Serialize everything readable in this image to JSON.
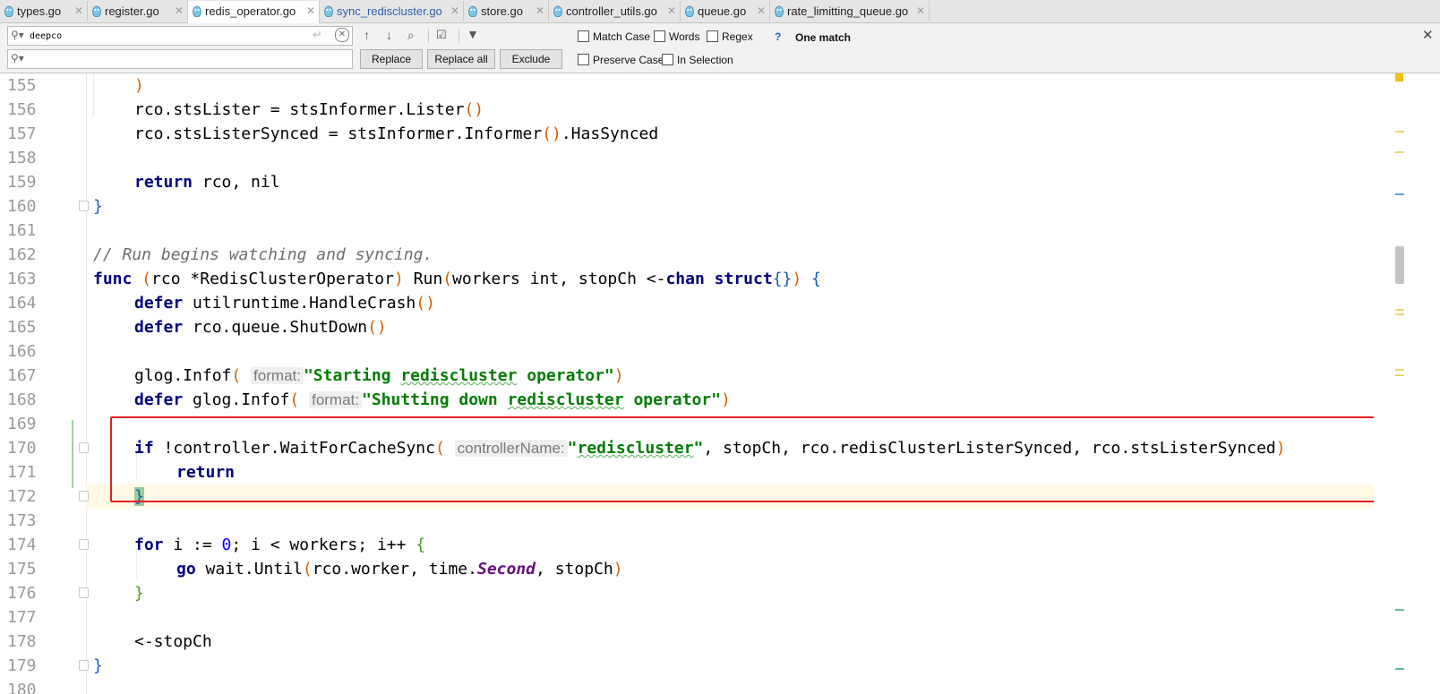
{
  "tabs": [
    {
      "label": "types.go",
      "active": false
    },
    {
      "label": "register.go",
      "active": false
    },
    {
      "label": "redis_operator.go",
      "active": true
    },
    {
      "label": "sync_rediscluster.go",
      "active": false
    },
    {
      "label": "store.go",
      "active": false
    },
    {
      "label": "controller_utils.go",
      "active": false
    },
    {
      "label": "queue.go",
      "active": false
    },
    {
      "label": "rate_limitting_queue.go",
      "active": false
    }
  ],
  "find": {
    "search_value": "deepco",
    "replace_value": "",
    "match_count": "One match",
    "options": {
      "match_case": "Match Case",
      "words": "Words",
      "regex": "Regex",
      "help": "?",
      "preserve_case": "Preserve Case",
      "in_selection": "In Selection"
    },
    "buttons": {
      "replace": "Replace",
      "replace_all": "Replace all",
      "exclude": "Exclude"
    }
  },
  "editor": {
    "line_numbers": [
      "155",
      "156",
      "157",
      "158",
      "159",
      "160",
      "161",
      "162",
      "163",
      "164",
      "165",
      "166",
      "167",
      "168",
      "169",
      "170",
      "171",
      "172",
      "173",
      "174",
      "175",
      "176",
      "177",
      "178",
      "179",
      "180"
    ],
    "tokens": {
      "l155_paren": ")",
      "l156_a": "rco.stsLister = stsInformer.Lister",
      "l156_p": "()",
      "l157_a": "rco.stsListerSynced = stsInformer.Informer",
      "l157_p": "()",
      "l157_b": ".HasSynced",
      "l159_kw": "return",
      "l159_rest": " rco, nil",
      "l160_brace": "}",
      "l162_comment": "// Run begins watching and syncing.",
      "l163_func": "func",
      "l163_p1": "(",
      "l163_recv": "rco *RedisClusterOperator",
      "l163_p2": ")",
      "l163_name": " Run",
      "l163_p3": "(",
      "l163_params": "workers int, stopCh <-",
      "l163_chan": "chan",
      "l163_struct": "struct",
      "l163_braces": "{}",
      "l163_p4": ")",
      "l163_open": "{",
      "l164_kw": "defer",
      "l164_call": " utilruntime.HandleCrash",
      "l164_p": "()",
      "l165_kw": "defer",
      "l165_call": " rco.queue.ShutDown",
      "l165_p": "()",
      "l167_call": "glog.Infof",
      "l167_p1": "(",
      "hint_format": "format:",
      "l167_str_a": "\"Starting ",
      "l167_str_squig": "rediscluster",
      "l167_str_b": " operator\"",
      "l167_p2": ")",
      "l168_kw": "defer",
      "l168_call": " glog.Infof",
      "l168_p1": "(",
      "l168_str_a": "\"Shutting down ",
      "l168_str_squig": "rediscluster",
      "l168_str_b": " operator\"",
      "l168_p2": ")",
      "l170_kw": "if",
      "l170_call": " !controller.WaitForCacheSync",
      "l170_p1": "(",
      "hint_controller": "controllerName:",
      "l170_q1": "\"",
      "l170_str_squig": "rediscluster",
      "l170_q2": "\"",
      "l170_rest": ", stopCh, rco.redisClusterListerSynced, rco.stsListerSynced",
      "l170_p2": ")",
      "l171_kw": "return",
      "l172_brace": "}",
      "l174_kw": "for",
      "l174_a": " i := ",
      "l174_num": "0",
      "l174_b": "; i < workers; i++ ",
      "l174_brace": "{",
      "l175_kw": "go",
      "l175_call": " wait.Until",
      "l175_p1": "(",
      "l175_a": "rco.worker, time.",
      "l175_second": "Second",
      "l175_b": ", stopCh",
      "l175_p2": ")",
      "l176_brace": "}",
      "l178_recv": "<-stopCh",
      "l179_brace": "}"
    }
  },
  "colors": {
    "keyword": "#000080",
    "string": "#007d00",
    "comment": "#6e6e6e",
    "number": "#0000ff",
    "paren": "#d45f00",
    "highlight_box": "#e02020",
    "caret_line": "#fffae3"
  },
  "icons": [
    "go-gopher-icon",
    "search-icon",
    "clear-search-icon",
    "history-icon",
    "prev-occurrence-icon",
    "next-occurrence-icon",
    "find-all-icon",
    "select-all-occurrences-icon",
    "filter-icon",
    "close-icon",
    "fold-icon"
  ]
}
